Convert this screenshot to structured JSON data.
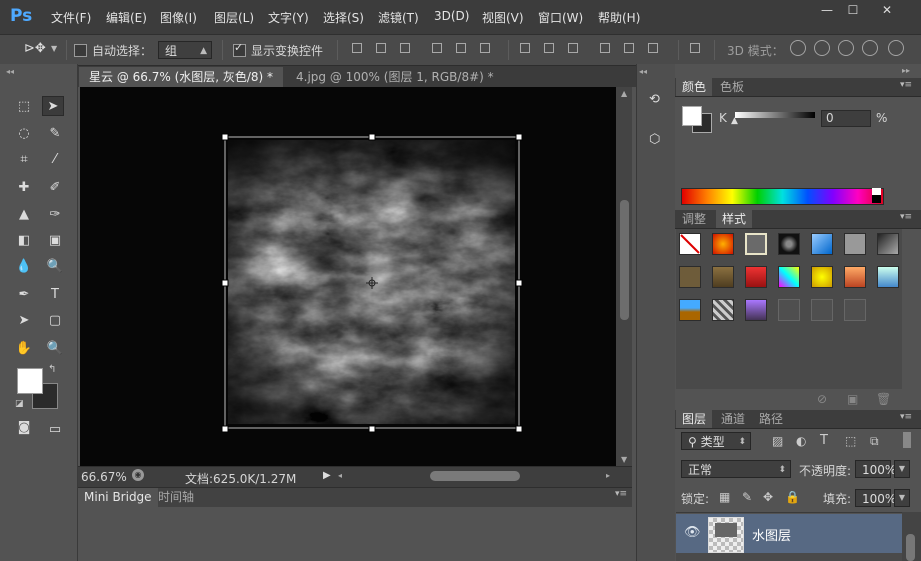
{
  "app": {
    "logo": "Ps"
  },
  "menu": [
    "文件(F)",
    "编辑(E)",
    "图像(I)",
    "图层(L)",
    "文字(Y)",
    "选择(S)",
    "滤镜(T)",
    "3D(D)",
    "视图(V)",
    "窗口(W)",
    "帮助(H)"
  ],
  "window_controls": {
    "minimize": "—",
    "maximize": "☐",
    "close": "✕"
  },
  "options": {
    "auto_select_label": "自动选择：",
    "auto_select_checked": false,
    "auto_select_target": "组",
    "show_transform_label": "显示变换控件",
    "show_transform_checked": true,
    "mode_3d_label": "3D 模式："
  },
  "tabs": [
    {
      "label": "星云 @ 66.7% (水图层, 灰色/8) *",
      "active": true
    },
    {
      "label": "4.jpg @ 100% (图层 1, RGB/8#) *",
      "active": false
    }
  ],
  "tab_close": "×",
  "status": {
    "zoom": "66.67%",
    "doc_label": "文档:625.0K/1.27M"
  },
  "bottom_tabs": [
    "Mini Bridge",
    "时间轴"
  ],
  "color_panel": {
    "tabs": [
      "颜色",
      "色板"
    ],
    "channel_label": "K",
    "value": "0",
    "unit": "%"
  },
  "styles_panel": {
    "tabs": [
      "调整",
      "样式"
    ]
  },
  "layers_panel": {
    "tabs": [
      "图层",
      "通道",
      "路径"
    ],
    "filter_label": "类型",
    "blend_mode": "正常",
    "opacity_label": "不透明度:",
    "opacity_value": "100%",
    "lock_label": "锁定:",
    "fill_label": "填充:",
    "fill_value": "100%",
    "layers": [
      {
        "name": "水图层",
        "visible": true,
        "selected": true
      }
    ]
  },
  "colors": {
    "menubar": "#3c3c3c",
    "panel": "#535353",
    "canvas": "#060606",
    "selected_layer": "#576983",
    "ps_blue": "#4ea9ff"
  }
}
